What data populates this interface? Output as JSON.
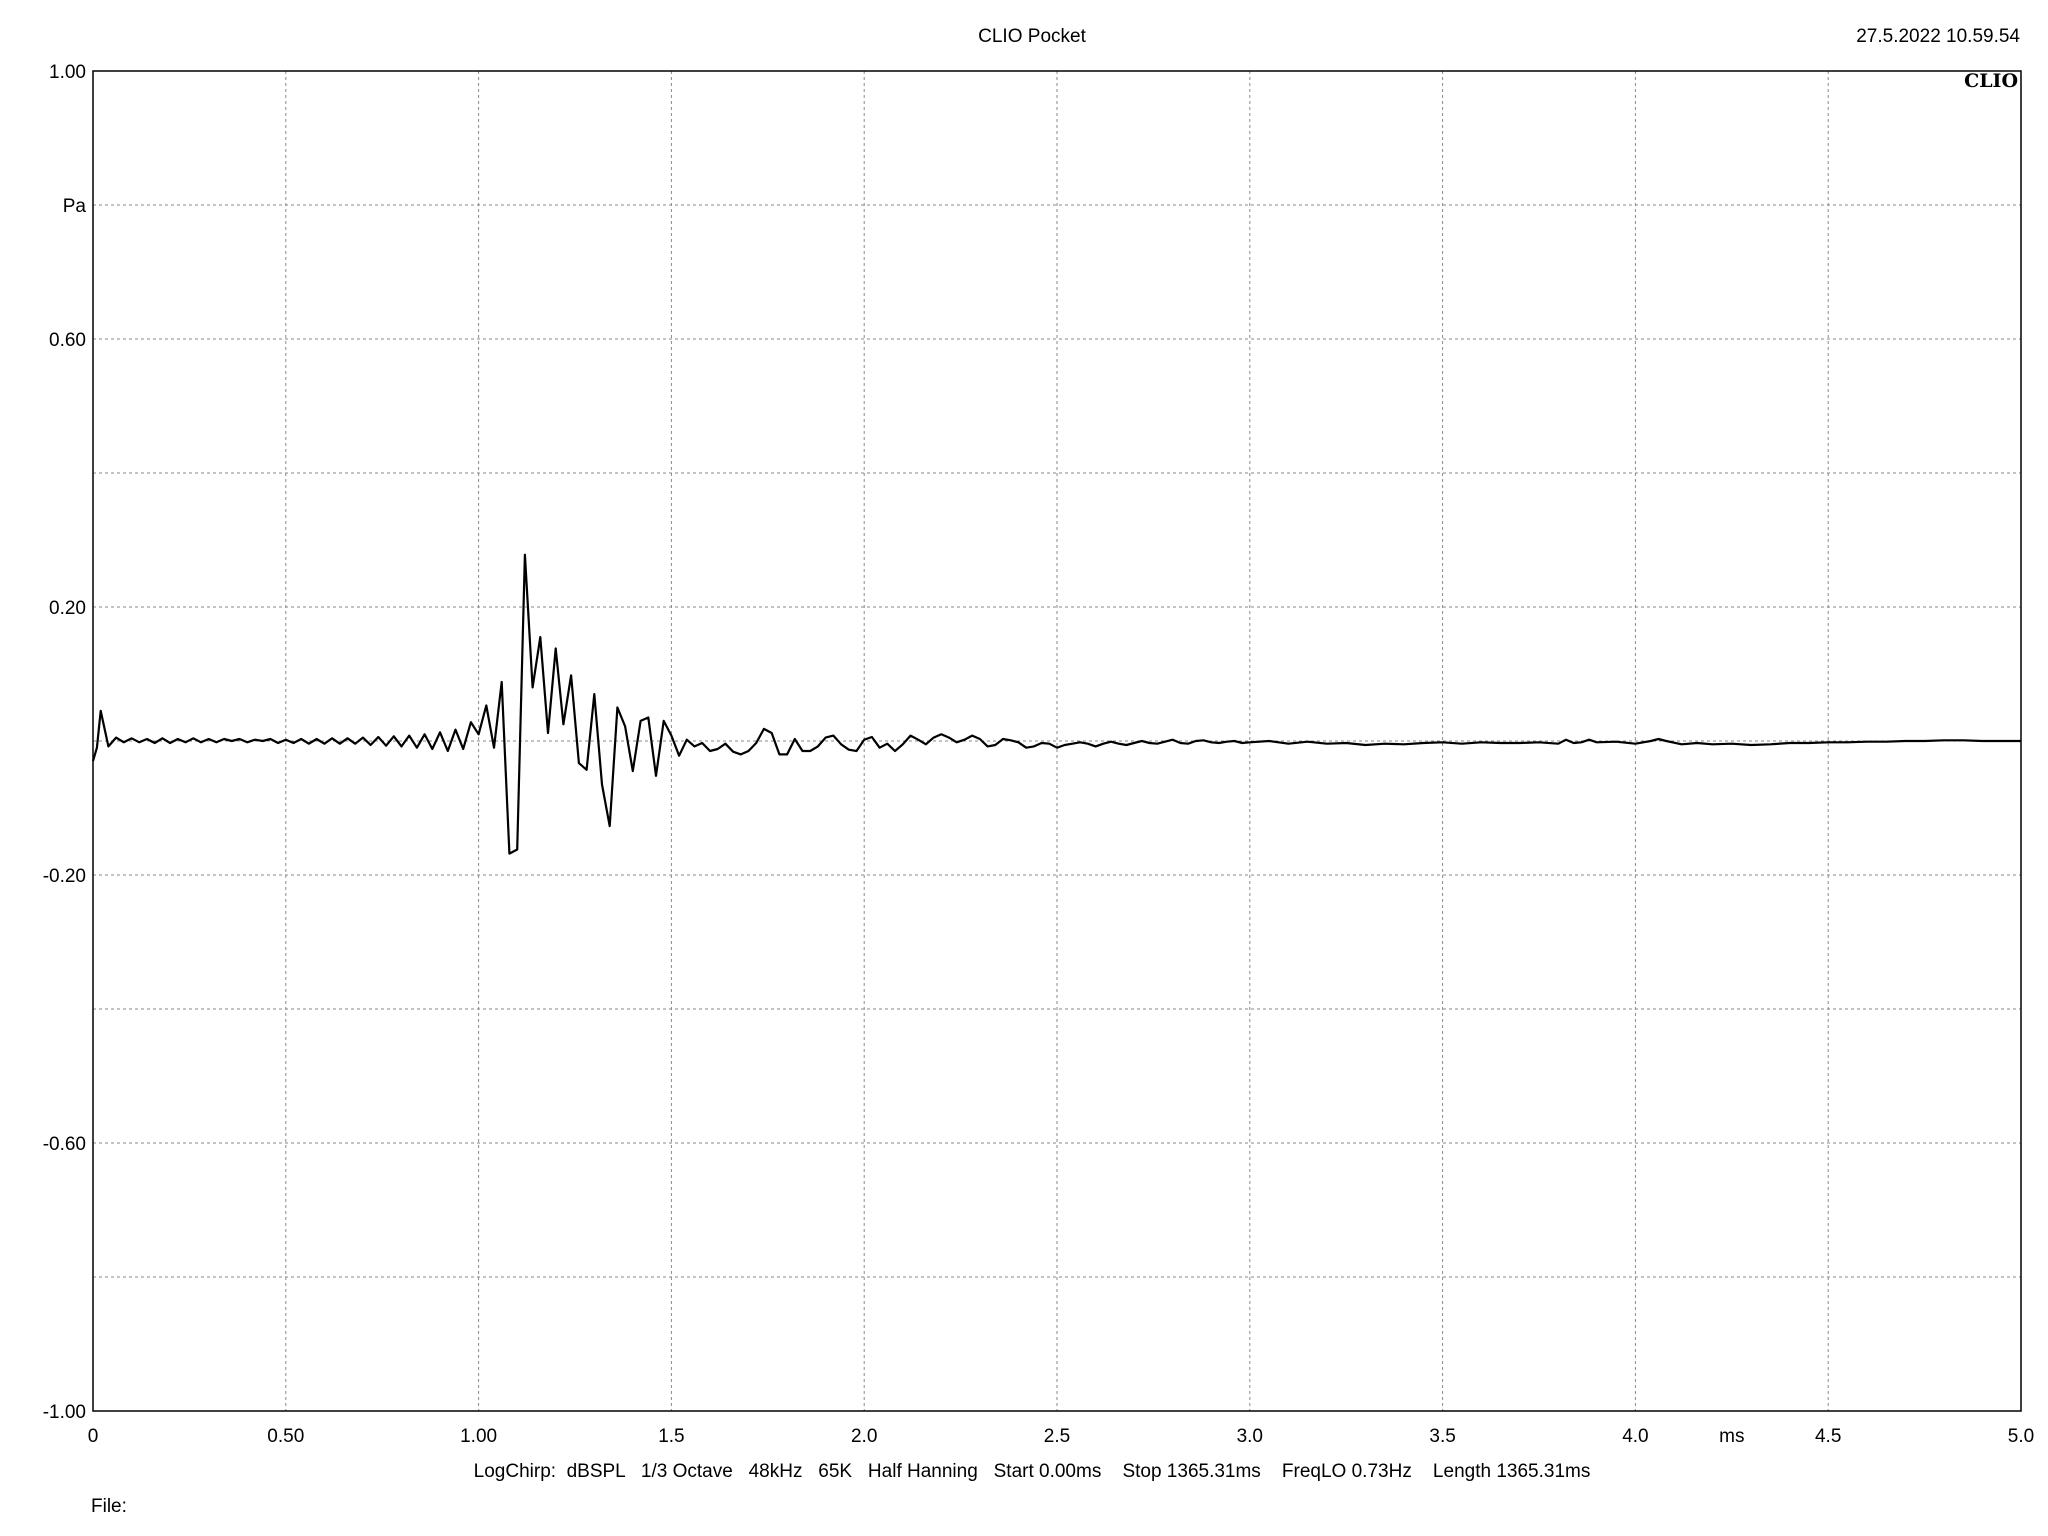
{
  "header": {
    "title": "CLIO Pocket",
    "timestamp": "27.5.2022 10.59.54",
    "logo": "CLIO"
  },
  "footer": {
    "settings": "LogChirp:  dBSPL   1/3 Octave   48kHz   65K   Half Hanning   Start 0.00ms    Stop 1365.31ms    FreqLO 0.73Hz    Length 1365.31ms",
    "file_label": "File:"
  },
  "chart_data": {
    "type": "line",
    "title": "CLIO Pocket",
    "xlabel": "ms",
    "ylabel": "Pa",
    "xlim": [
      0,
      5.0
    ],
    "ylim": [
      -1.0,
      1.0
    ],
    "grid": true,
    "x_ticks": [
      {
        "value": 0,
        "label": "0"
      },
      {
        "value": 0.5,
        "label": "0.50"
      },
      {
        "value": 1.0,
        "label": "1.00"
      },
      {
        "value": 1.5,
        "label": "1.5"
      },
      {
        "value": 2.0,
        "label": "2.0"
      },
      {
        "value": 2.5,
        "label": "2.5"
      },
      {
        "value": 3.0,
        "label": "3.0"
      },
      {
        "value": 3.5,
        "label": "3.5"
      },
      {
        "value": 4.0,
        "label": "4.0"
      },
      {
        "value": 4.5,
        "label": "4.5"
      },
      {
        "value": 5.0,
        "label": "5.0"
      }
    ],
    "x_unit_position": 4.25,
    "y_ticks": [
      {
        "value": 1.0,
        "label": "1.00"
      },
      {
        "value": 0.8,
        "label": "Pa"
      },
      {
        "value": 0.6,
        "label": "0.60"
      },
      {
        "value": 0.4,
        "label": ""
      },
      {
        "value": 0.2,
        "label": "0.20"
      },
      {
        "value": 0.0,
        "label": ""
      },
      {
        "value": -0.2,
        "label": "-0.20"
      },
      {
        "value": -0.4,
        "label": ""
      },
      {
        "value": -0.6,
        "label": "-0.60"
      },
      {
        "value": -0.8,
        "label": ""
      },
      {
        "value": -1.0,
        "label": "-1.00"
      }
    ],
    "series": [
      {
        "color": "#000000",
        "points": [
          [
            0.0,
            -0.03
          ],
          [
            0.01,
            -0.01
          ],
          [
            0.02,
            0.045
          ],
          [
            0.04,
            -0.008
          ],
          [
            0.06,
            0.005
          ],
          [
            0.08,
            -0.002
          ],
          [
            0.1,
            0.004
          ],
          [
            0.12,
            -0.002
          ],
          [
            0.14,
            0.003
          ],
          [
            0.16,
            -0.003
          ],
          [
            0.18,
            0.004
          ],
          [
            0.2,
            -0.003
          ],
          [
            0.22,
            0.003
          ],
          [
            0.24,
            -0.002
          ],
          [
            0.26,
            0.004
          ],
          [
            0.28,
            -0.002
          ],
          [
            0.3,
            0.003
          ],
          [
            0.32,
            -0.002
          ],
          [
            0.34,
            0.003
          ],
          [
            0.36,
            0.0
          ],
          [
            0.38,
            0.003
          ],
          [
            0.4,
            -0.002
          ],
          [
            0.42,
            0.002
          ],
          [
            0.44,
            0.0
          ],
          [
            0.46,
            0.003
          ],
          [
            0.48,
            -0.003
          ],
          [
            0.5,
            0.002
          ],
          [
            0.52,
            -0.003
          ],
          [
            0.54,
            0.003
          ],
          [
            0.56,
            -0.004
          ],
          [
            0.58,
            0.003
          ],
          [
            0.6,
            -0.004
          ],
          [
            0.62,
            0.004
          ],
          [
            0.64,
            -0.004
          ],
          [
            0.66,
            0.004
          ],
          [
            0.68,
            -0.004
          ],
          [
            0.7,
            0.005
          ],
          [
            0.72,
            -0.006
          ],
          [
            0.74,
            0.006
          ],
          [
            0.76,
            -0.007
          ],
          [
            0.78,
            0.007
          ],
          [
            0.8,
            -0.008
          ],
          [
            0.82,
            0.008
          ],
          [
            0.84,
            -0.01
          ],
          [
            0.86,
            0.01
          ],
          [
            0.88,
            -0.012
          ],
          [
            0.9,
            0.013
          ],
          [
            0.92,
            -0.015
          ],
          [
            0.94,
            0.017
          ],
          [
            0.96,
            -0.012
          ],
          [
            0.98,
            0.028
          ],
          [
            1.0,
            0.01
          ],
          [
            1.02,
            0.053
          ],
          [
            1.04,
            -0.01
          ],
          [
            1.06,
            0.088
          ],
          [
            1.08,
            -0.168
          ],
          [
            1.1,
            -0.162
          ],
          [
            1.12,
            0.278
          ],
          [
            1.14,
            0.08
          ],
          [
            1.16,
            0.155
          ],
          [
            1.18,
            0.012
          ],
          [
            1.2,
            0.138
          ],
          [
            1.22,
            0.025
          ],
          [
            1.24,
            0.098
          ],
          [
            1.26,
            -0.033
          ],
          [
            1.28,
            -0.043
          ],
          [
            1.3,
            0.07
          ],
          [
            1.32,
            -0.065
          ],
          [
            1.34,
            -0.127
          ],
          [
            1.36,
            0.05
          ],
          [
            1.38,
            0.022
          ],
          [
            1.4,
            -0.045
          ],
          [
            1.42,
            0.03
          ],
          [
            1.44,
            0.035
          ],
          [
            1.46,
            -0.052
          ],
          [
            1.48,
            0.03
          ],
          [
            1.5,
            0.008
          ],
          [
            1.52,
            -0.022
          ],
          [
            1.54,
            0.002
          ],
          [
            1.56,
            -0.008
          ],
          [
            1.58,
            -0.003
          ],
          [
            1.6,
            -0.015
          ],
          [
            1.62,
            -0.012
          ],
          [
            1.64,
            -0.004
          ],
          [
            1.66,
            -0.016
          ],
          [
            1.68,
            -0.02
          ],
          [
            1.7,
            -0.015
          ],
          [
            1.72,
            -0.003
          ],
          [
            1.74,
            0.018
          ],
          [
            1.76,
            0.012
          ],
          [
            1.78,
            -0.02
          ],
          [
            1.8,
            -0.02
          ],
          [
            1.82,
            0.003
          ],
          [
            1.84,
            -0.015
          ],
          [
            1.86,
            -0.015
          ],
          [
            1.88,
            -0.008
          ],
          [
            1.9,
            0.005
          ],
          [
            1.92,
            0.008
          ],
          [
            1.94,
            -0.005
          ],
          [
            1.96,
            -0.013
          ],
          [
            1.98,
            -0.015
          ],
          [
            2.0,
            0.002
          ],
          [
            2.02,
            0.006
          ],
          [
            2.04,
            -0.01
          ],
          [
            2.06,
            -0.004
          ],
          [
            2.08,
            -0.015
          ],
          [
            2.1,
            -0.005
          ],
          [
            2.12,
            0.008
          ],
          [
            2.14,
            0.002
          ],
          [
            2.16,
            -0.005
          ],
          [
            2.18,
            0.005
          ],
          [
            2.2,
            0.01
          ],
          [
            2.22,
            0.005
          ],
          [
            2.24,
            -0.002
          ],
          [
            2.26,
            0.002
          ],
          [
            2.28,
            0.008
          ],
          [
            2.3,
            0.003
          ],
          [
            2.32,
            -0.008
          ],
          [
            2.34,
            -0.006
          ],
          [
            2.36,
            0.003
          ],
          [
            2.38,
            0.001
          ],
          [
            2.4,
            -0.002
          ],
          [
            2.42,
            -0.01
          ],
          [
            2.44,
            -0.008
          ],
          [
            2.46,
            -0.003
          ],
          [
            2.48,
            -0.004
          ],
          [
            2.5,
            -0.01
          ],
          [
            2.52,
            -0.006
          ],
          [
            2.54,
            -0.004
          ],
          [
            2.56,
            -0.002
          ],
          [
            2.58,
            -0.004
          ],
          [
            2.6,
            -0.008
          ],
          [
            2.62,
            -0.004
          ],
          [
            2.64,
            -0.001
          ],
          [
            2.66,
            -0.004
          ],
          [
            2.68,
            -0.006
          ],
          [
            2.7,
            -0.003
          ],
          [
            2.72,
            0.0
          ],
          [
            2.74,
            -0.003
          ],
          [
            2.76,
            -0.004
          ],
          [
            2.78,
            -0.001
          ],
          [
            2.8,
            0.002
          ],
          [
            2.82,
            -0.003
          ],
          [
            2.84,
            -0.004
          ],
          [
            2.86,
            0.0
          ],
          [
            2.88,
            0.001
          ],
          [
            2.9,
            -0.002
          ],
          [
            2.92,
            -0.003
          ],
          [
            2.94,
            -0.001
          ],
          [
            2.96,
            0.0
          ],
          [
            2.98,
            -0.003
          ],
          [
            3.0,
            -0.002
          ],
          [
            3.05,
            0.0
          ],
          [
            3.1,
            -0.004
          ],
          [
            3.15,
            -0.001
          ],
          [
            3.2,
            -0.004
          ],
          [
            3.25,
            -0.003
          ],
          [
            3.3,
            -0.006
          ],
          [
            3.35,
            -0.004
          ],
          [
            3.4,
            -0.005
          ],
          [
            3.45,
            -0.003
          ],
          [
            3.5,
            -0.002
          ],
          [
            3.55,
            -0.004
          ],
          [
            3.6,
            -0.002
          ],
          [
            3.65,
            -0.003
          ],
          [
            3.7,
            -0.003
          ],
          [
            3.75,
            -0.002
          ],
          [
            3.8,
            -0.004
          ],
          [
            3.82,
            0.002
          ],
          [
            3.84,
            -0.003
          ],
          [
            3.86,
            -0.002
          ],
          [
            3.88,
            0.002
          ],
          [
            3.9,
            -0.002
          ],
          [
            3.95,
            -0.001
          ],
          [
            4.0,
            -0.004
          ],
          [
            4.04,
            0.0
          ],
          [
            4.06,
            0.003
          ],
          [
            4.08,
            0.0
          ],
          [
            4.12,
            -0.005
          ],
          [
            4.16,
            -0.003
          ],
          [
            4.2,
            -0.005
          ],
          [
            4.25,
            -0.004
          ],
          [
            4.3,
            -0.006
          ],
          [
            4.35,
            -0.005
          ],
          [
            4.4,
            -0.003
          ],
          [
            4.45,
            -0.003
          ],
          [
            4.5,
            -0.002
          ],
          [
            4.55,
            -0.002
          ],
          [
            4.6,
            -0.001
          ],
          [
            4.65,
            -0.001
          ],
          [
            4.7,
            0.0
          ],
          [
            4.75,
            0.0
          ],
          [
            4.8,
            0.001
          ],
          [
            4.85,
            0.001
          ],
          [
            4.9,
            0.0
          ],
          [
            4.95,
            0.0
          ],
          [
            5.0,
            0.0
          ]
        ]
      }
    ]
  }
}
